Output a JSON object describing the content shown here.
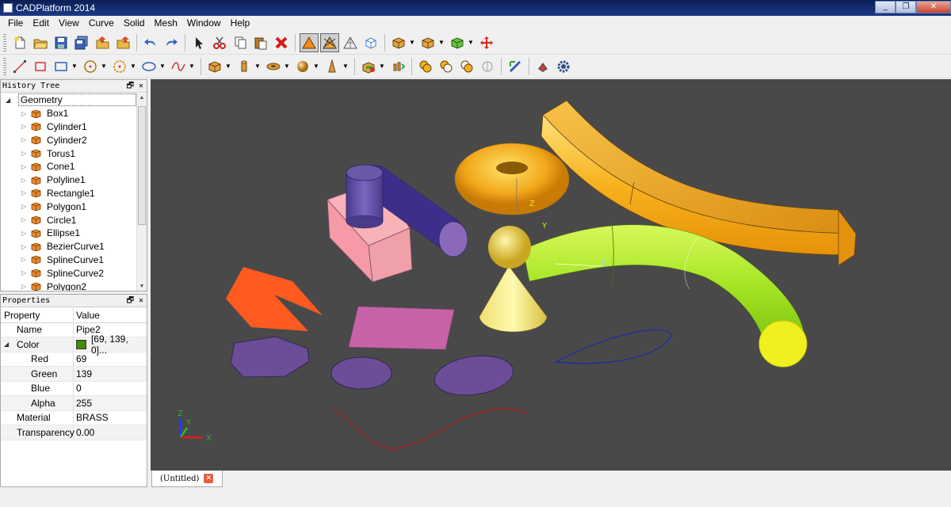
{
  "window": {
    "title": "CADPlatform 2014",
    "minimize": "_",
    "restore": "❐",
    "close": "✕"
  },
  "menu": [
    "File",
    "Edit",
    "View",
    "Curve",
    "Solid",
    "Mesh",
    "Window",
    "Help"
  ],
  "history_tree": {
    "title": "History Tree",
    "root": "Geometry",
    "items": [
      "Box1",
      "Cylinder1",
      "Cylinder2",
      "Torus1",
      "Cone1",
      "Polyline1",
      "Rectangle1",
      "Polygon1",
      "Circle1",
      "Ellipse1",
      "BezierCurve1",
      "SplineCurve1",
      "SplineCurve2",
      "Polygon2"
    ]
  },
  "properties": {
    "title": "Properties",
    "header": {
      "property": "Property",
      "value": "Value"
    },
    "rows": [
      {
        "name": "Name",
        "value": "Pipe2",
        "indent": 0
      },
      {
        "name": "Color",
        "value": "[69, 139, 0]...",
        "indent": 0,
        "swatch": "#458b00",
        "expander": "◢"
      },
      {
        "name": "Red",
        "value": "69",
        "indent": 1
      },
      {
        "name": "Green",
        "value": "139",
        "indent": 1
      },
      {
        "name": "Blue",
        "value": "0",
        "indent": 1
      },
      {
        "name": "Alpha",
        "value": "255",
        "indent": 1
      },
      {
        "name": "Material",
        "value": "BRASS",
        "indent": 0
      },
      {
        "name": "Transparency",
        "value": "0.00",
        "indent": 0
      }
    ]
  },
  "panel_buttons": "🗗 ✕",
  "tab": {
    "label": "(Untitled)",
    "close": "✕"
  },
  "axes": {
    "x": "X",
    "y": "Y",
    "z": "Z"
  },
  "colors": {
    "viewport_bg": "#494949",
    "brass": "#f5b52a",
    "pipe": "#a8e830",
    "accent_orange": "#ff5a1f",
    "purple": "#6b4d98"
  }
}
